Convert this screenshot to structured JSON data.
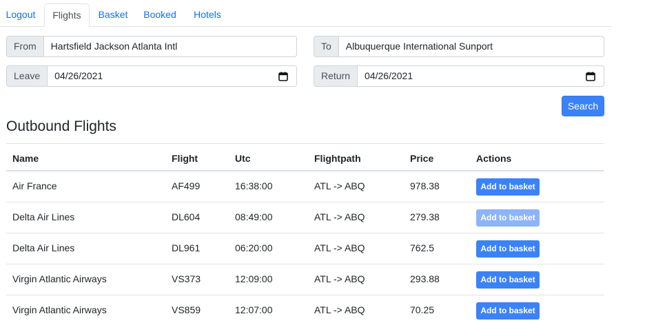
{
  "nav": {
    "tabs": [
      {
        "label": "Logout",
        "active": false
      },
      {
        "label": "Flights",
        "active": true
      },
      {
        "label": "Basket",
        "active": false
      },
      {
        "label": "Booked",
        "active": false
      },
      {
        "label": "Hotels",
        "active": false
      }
    ]
  },
  "form": {
    "from_label": "From",
    "from_value": "Hartsfield Jackson Atlanta Intl",
    "to_label": "To",
    "to_value": "Albuquerque International Sunport",
    "leave_label": "Leave",
    "leave_value": "04/26/2021",
    "return_label": "Return",
    "return_value": "04/26/2021",
    "search_label": "Search"
  },
  "outbound": {
    "title": "Outbound Flights",
    "headers": [
      "Name",
      "Flight",
      "Utc",
      "Flightpath",
      "Price",
      "Actions"
    ],
    "rows": [
      {
        "name": "Air France",
        "flight": "AF499",
        "utc": "16:38:00",
        "path": "ATL -> ABQ",
        "price": "978.38",
        "action": "Add to basket",
        "disabled": false
      },
      {
        "name": "Delta Air Lines",
        "flight": "DL604",
        "utc": "08:49:00",
        "path": "ATL -> ABQ",
        "price": "279.38",
        "action": "Add to basket",
        "disabled": true
      },
      {
        "name": "Delta Air Lines",
        "flight": "DL961",
        "utc": "06:20:00",
        "path": "ATL -> ABQ",
        "price": "762.5",
        "action": "Add to basket",
        "disabled": false
      },
      {
        "name": "Virgin Atlantic Airways",
        "flight": "VS373",
        "utc": "12:09:00",
        "path": "ATL -> ABQ",
        "price": "293.88",
        "action": "Add to basket",
        "disabled": false
      },
      {
        "name": "Virgin Atlantic Airways",
        "flight": "VS859",
        "utc": "12:07:00",
        "path": "ATL -> ABQ",
        "price": "70.25",
        "action": "Add to basket",
        "disabled": false
      }
    ]
  },
  "colors": {
    "accent": "#3b82f6",
    "accent_disabled": "#8db4f8",
    "link": "#0d6efd"
  },
  "icons": {
    "date_picker": "calendar-icon"
  }
}
